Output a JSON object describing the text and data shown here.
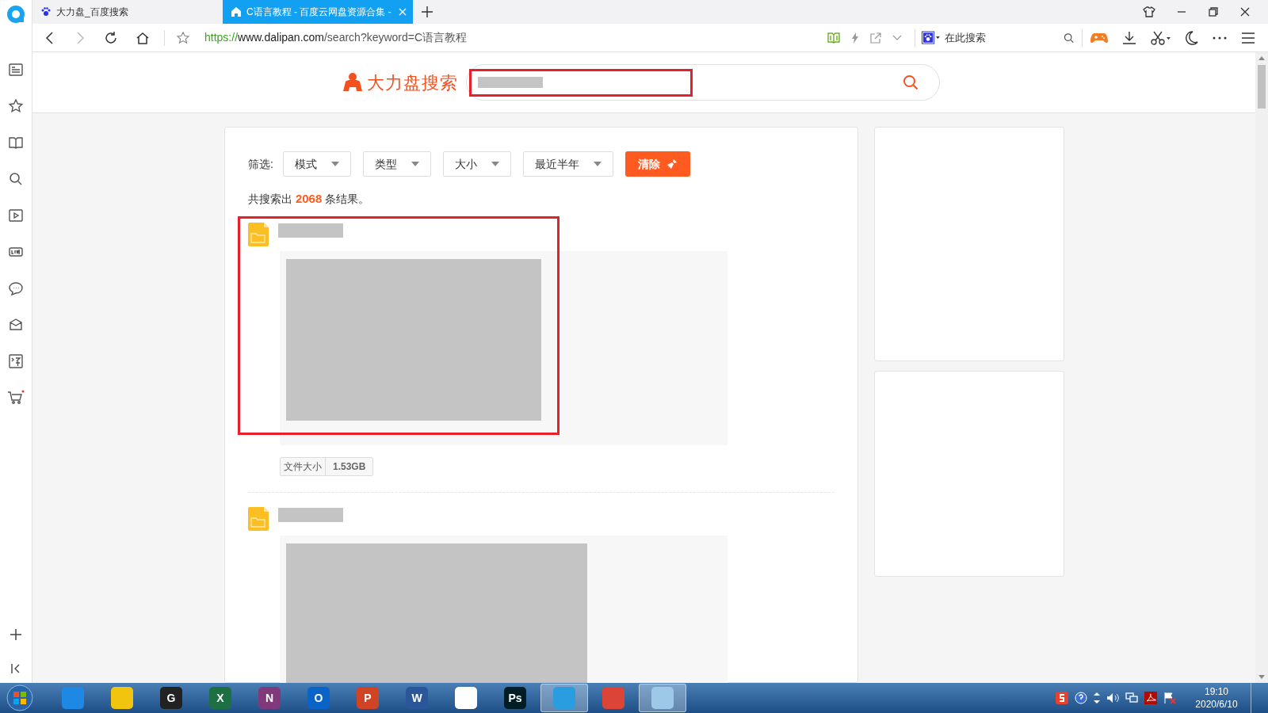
{
  "tabs": [
    {
      "label": "大力盘_百度搜索",
      "selected": false
    },
    {
      "label": "C语言教程 - 百度云网盘资源合集 -",
      "selected": true
    }
  ],
  "address_bar": {
    "scheme": "https://",
    "host": "www.dalipan.com",
    "path": "/search?keyword=C语言教程"
  },
  "toolbar_search": {
    "placeholder": "在此搜索"
  },
  "site": {
    "logo": "大力盘搜索"
  },
  "filters": {
    "label": "筛选:",
    "dropdowns": [
      "模式",
      "类型",
      "大小",
      "最近半年"
    ],
    "clear_button": "清除"
  },
  "result_count": {
    "prefix": "共搜索出",
    "count": "2068",
    "suffix": "条结果。"
  },
  "results": [
    {
      "kind": "folder",
      "highlighted": true,
      "tags": [
        {
          "label": "文件大小",
          "value": "1.53GB"
        }
      ]
    },
    {
      "kind": "folder",
      "highlighted": false
    }
  ],
  "taskbar": {
    "apps": [
      {
        "color": "#1e88e5",
        "active": false
      },
      {
        "color": "#f1c40f",
        "active": false
      },
      {
        "glyph": "G",
        "color": "#222222",
        "active": false
      },
      {
        "glyph": "X",
        "color": "#1d7044",
        "active": false
      },
      {
        "glyph": "N",
        "color": "#80397b",
        "active": false
      },
      {
        "glyph": "O",
        "color": "#0a64c8",
        "active": false
      },
      {
        "glyph": "P",
        "color": "#d04423",
        "active": false
      },
      {
        "glyph": "W",
        "color": "#2b579a",
        "active": false
      },
      {
        "color": "#ffffff",
        "active": false
      },
      {
        "glyph": "Ps",
        "color": "#001d26",
        "active": false
      },
      {
        "color": "#2a9de0",
        "active": true
      },
      {
        "color": "#db4437",
        "active": false
      },
      {
        "color": "#9ec8e8",
        "active": true
      }
    ],
    "time": "19:10",
    "date": "2020/6/10"
  }
}
